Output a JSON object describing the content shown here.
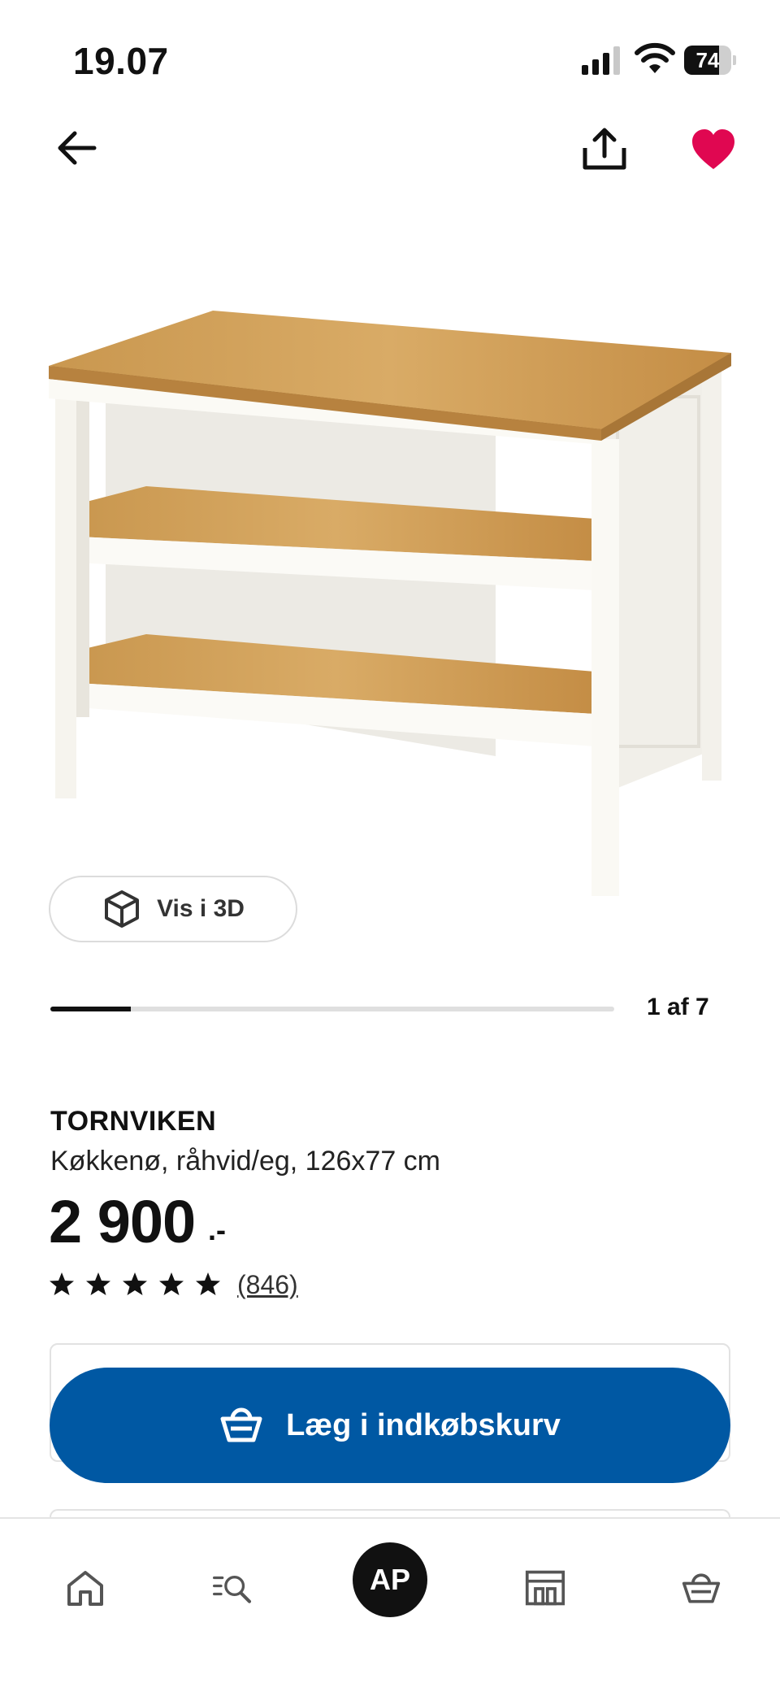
{
  "status_bar": {
    "time": "19.07",
    "battery": "74",
    "battery_level": 0.74
  },
  "nav": {
    "back_icon": "arrow-left-icon",
    "share_icon": "share-icon",
    "favorite_icon": "heart-filled-icon",
    "favorite_color": "#e00751"
  },
  "gallery": {
    "view_3d_label": "Vis i 3D",
    "position_label": "1 af 7",
    "current": 1,
    "total": 7
  },
  "product": {
    "name": "TORNVIKEN",
    "description": "Køkkenø, råhvid/eg, 126x77 cm",
    "price": "2 900",
    "price_suffix": ".-",
    "rating": 5,
    "review_count": "(846)"
  },
  "actions": {
    "add_to_cart_label": "Læg i indkøbskurv",
    "accent_color": "#0058a3"
  },
  "tab_bar": {
    "items": [
      {
        "icon": "home-icon"
      },
      {
        "icon": "search-list-icon"
      },
      {
        "avatar_initials": "AP"
      },
      {
        "icon": "store-icon"
      },
      {
        "icon": "basket-icon"
      }
    ]
  }
}
